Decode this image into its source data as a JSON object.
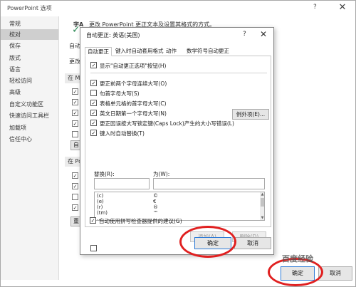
{
  "outer": {
    "title": "PowerPoint 选项",
    "help": "?",
    "close": "✕",
    "nav": [
      "常规",
      "校对",
      "保存",
      "版式",
      "语言",
      "轻松访问",
      "高级",
      "自定义功能区",
      "快速访问工具栏",
      "加载项",
      "信任中心"
    ],
    "active_nav": 1,
    "header_frag": "字A",
    "header_text": "更改 PowerPoint 更正文本及设置其格式的方式。",
    "frags": {
      "autocorrect": "自动",
      "change": "更改",
      "sec1": "在 M",
      "sec2": "在 Po",
      "btn1": "自",
      "btn2": "重"
    },
    "ok": "确定",
    "cancel": "取消"
  },
  "dialog": {
    "title": "自动更正: 英语(美国)",
    "help": "?",
    "close": "✕",
    "tabs": [
      "自动更正",
      "键入时自动套用格式",
      "动作",
      "数学符号自动更正"
    ],
    "show_buttons": "显示\"自动更正选项\"按钮(H)",
    "options": [
      "更正前两个字母连续大写(O)",
      "句首字母大写(S)",
      "表格单元格的首字母大写(C)",
      "英文日期第一个字母大写(N)",
      "更正因误按大写锁定键(Caps Lock)产生的大小写错误(L)",
      "键入时自动替换(T)"
    ],
    "exceptions": "例外项(E)...",
    "replace_label": "替换(R):",
    "with_label": "为(W):",
    "entries": [
      {
        "key": "(c)",
        "value": "©"
      },
      {
        "key": "(e)",
        "value": "€"
      },
      {
        "key": "(r)",
        "value": "®"
      },
      {
        "key": "(tm)",
        "value": "™"
      },
      {
        "key": "...",
        "value": "…"
      }
    ],
    "add": "添加(A)",
    "delete": "删除(D)",
    "spell_suggest": "自动使用拼写检查器提供的建议(G)",
    "ok": "确定",
    "cancel": "取消"
  },
  "watermark": "百度经验",
  "colors": {
    "annotation": "#e02020",
    "accent": "#2e7bd6"
  }
}
